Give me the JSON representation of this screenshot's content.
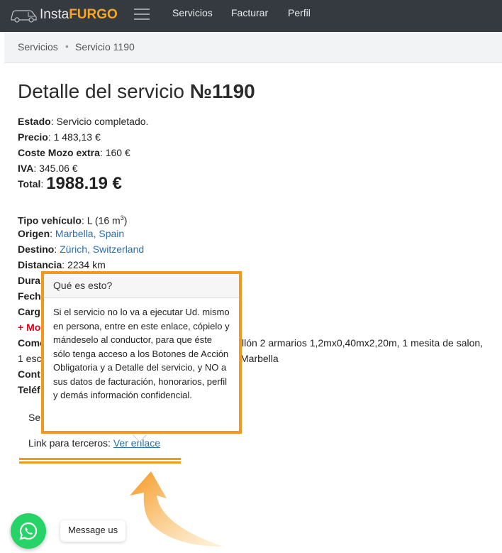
{
  "brand": {
    "prefix": "Insta",
    "suffix": "FURGO"
  },
  "nav": {
    "items": [
      "Servicios",
      "Facturar",
      "Perfil"
    ]
  },
  "breadcrumb": {
    "parent": "Servicios",
    "separator": "•",
    "current": "Servicio 1190"
  },
  "title": {
    "prefix": "Detalle del servicio ",
    "number": "№1190"
  },
  "summary": {
    "estado_label": "Estado",
    "estado_value": ": Servicio completado.",
    "precio_label": "Precio",
    "precio_value": ": 1 483,13 €",
    "coste_label": "Coste Mozo extra",
    "coste_value": ": 160  €",
    "iva_label": "IVA",
    "iva_value": ": 345.06 €",
    "total_label": "Total",
    "total_sep": ": ",
    "total_value": "1988.19 €"
  },
  "details": {
    "vehiculo_label": "Tipo vehículo",
    "vehiculo_value": ": L (16 m",
    "vehiculo_sup": "3",
    "vehiculo_close": ")",
    "origen_label": "Origen",
    "origen_value": "Marbella, Spain",
    "destino_label": "Destino",
    "destino_value": "Zürich, Switzerland",
    "distancia_label": "Distancia",
    "distancia_value": ": 2234 km",
    "dura_label": "Dura",
    "fech_label": "Fech",
    "carg_label": "Carg",
    "mo_label": "+ Mo",
    "come_label": "Come",
    "come_visible": "llón 2 armarios 1,2mx0,40mx2,20m, 1 mesita de salon,",
    "come_line2_start": "1 esc",
    "come_line2_end": "Marbella",
    "cont_label": "Cont",
    "tele_label": "Teléf",
    "ser_label": "Ser"
  },
  "third_party": {
    "label": "Link para terceros: ",
    "link": "Ver enlace"
  },
  "popover": {
    "title": "Qué es esto?",
    "body": "Si el servicio no lo va a ejecutar Ud. mismo en persona, entre en este enlace, cópielo y mándeselo al conductor, para que éste sólo tenga acceso a los Botones de Acción Obligatoria y a Detalle del servicio, y NO a sus datos de facturación, honorarios, perfil y demás información confidencial."
  },
  "whatsapp": {
    "label": "Message us"
  },
  "colors": {
    "accent": "#f5961f",
    "brand_orange": "#f5a623",
    "topbar": "#343a40",
    "link": "#2a6fb0",
    "red": "#e0001a",
    "whatsapp": "#25d366"
  }
}
